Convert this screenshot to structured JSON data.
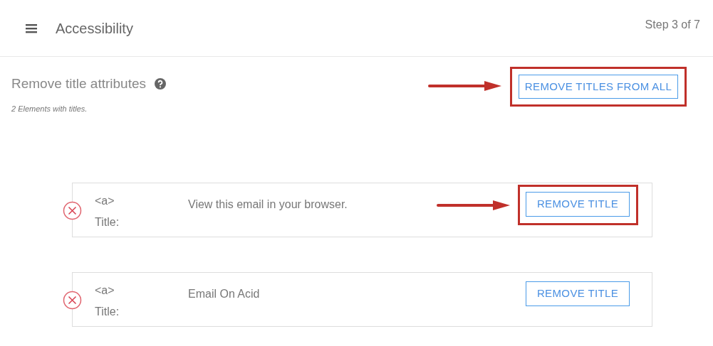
{
  "header": {
    "title": "Accessibility",
    "step": "Step 3 of 7"
  },
  "section": {
    "title": "Remove title attributes",
    "subtitle": "2 Elements with titles.",
    "action": {
      "label": "REMOVE TITLES FROM ALL",
      "highlighted": true
    }
  },
  "items": [
    {
      "tag": "<a>",
      "label": "Title:",
      "value": "View this email in your browser.",
      "button": "REMOVE TITLE",
      "highlighted": true
    },
    {
      "tag": "<a>",
      "label": "Title:",
      "value": "Email On Acid",
      "button": "REMOVE TITLE",
      "highlighted": false
    }
  ]
}
